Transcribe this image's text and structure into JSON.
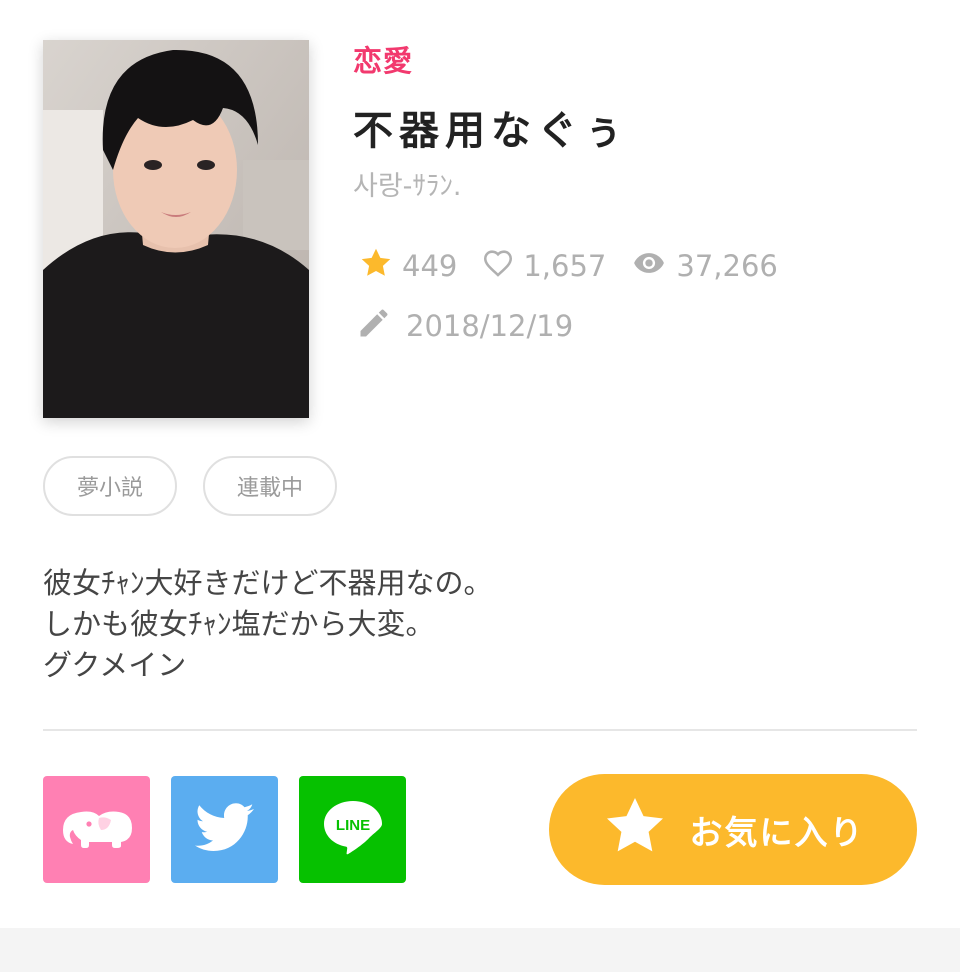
{
  "story": {
    "genre": "恋愛",
    "title": "不器用なぐぅ",
    "author": "사랑-ｻﾗﾝ.",
    "cover_alt": "表紙画像",
    "stats": {
      "stars": "449",
      "likes": "1,657",
      "views": "37,266"
    },
    "updated": "2018/12/19",
    "tags": [
      "夢小説",
      "連載中"
    ],
    "description": [
      "彼女ﾁｬﾝ大好きだけど不器用なの。",
      "しかも彼女ﾁｬﾝ塩だから大変。",
      "グクメイン"
    ]
  },
  "share": {
    "line_label": "LINE"
  },
  "actions": {
    "favorite_label": "お気に入り"
  },
  "colors": {
    "genre": "#f2396e",
    "star": "#fcb92c",
    "elephant": "#ff80b3",
    "twitter": "#5badf0",
    "line": "#06c100",
    "favorite": "#fcb92c"
  },
  "icons": {
    "stars": "star-icon",
    "likes": "heart-icon",
    "views": "eye-icon",
    "updated": "pencil-icon",
    "share_1": "elephant-icon",
    "share_2": "twitter-bird-icon",
    "share_3": "line-icon",
    "favorite": "star-icon"
  }
}
